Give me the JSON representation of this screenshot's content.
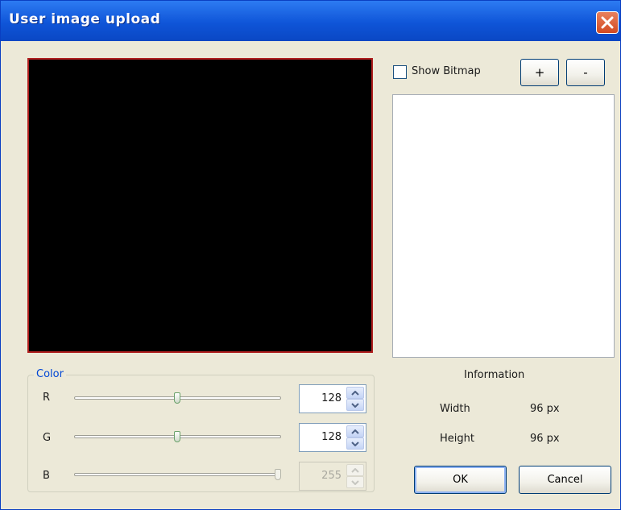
{
  "window": {
    "title": "User image upload",
    "close_icon": "close-x-icon"
  },
  "bitmap": {
    "show_bitmap_label": "Show Bitmap",
    "show_bitmap_checked": false,
    "zoom_in_label": "+",
    "zoom_out_label": "-"
  },
  "color": {
    "group_label": "Color",
    "channels": [
      {
        "label": "R",
        "value": "128",
        "level": 0.5,
        "enabled": true
      },
      {
        "label": "G",
        "value": "128",
        "level": 0.5,
        "enabled": true
      },
      {
        "label": "B",
        "value": "255",
        "level": 1.0,
        "enabled": false
      }
    ]
  },
  "info": {
    "title": "Information",
    "width_label": "Width",
    "width_value": "96 px",
    "height_label": "Height",
    "height_value": "96 px"
  },
  "buttons": {
    "ok": "OK",
    "cancel": "Cancel"
  },
  "colors": {
    "titlebar": "#0f55d8",
    "preview_background": "#000000",
    "preview_border": "#b01e1e",
    "dialog_background": "#ece9d8"
  }
}
